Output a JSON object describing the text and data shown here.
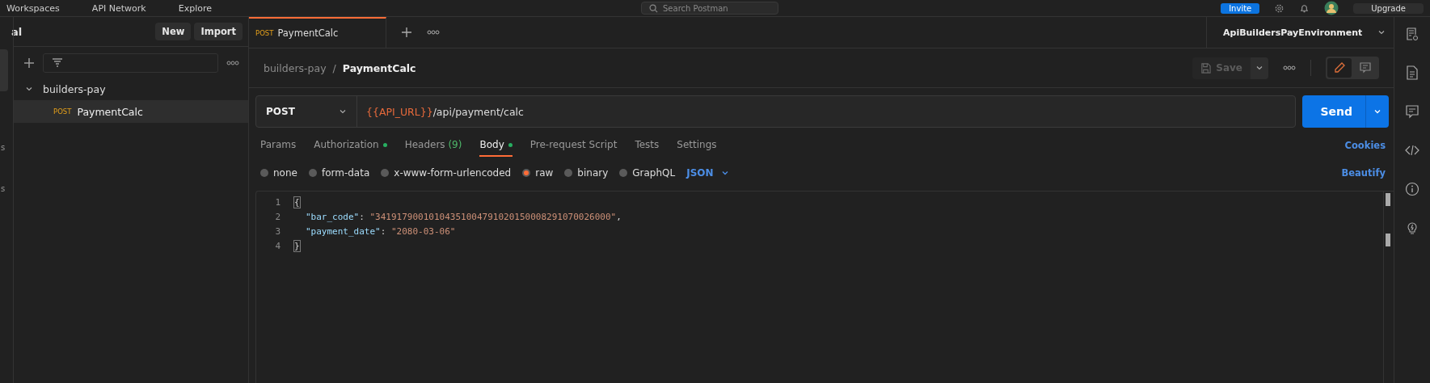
{
  "top_bar": {
    "nav": [
      "Workspaces",
      "API Network",
      "Explore"
    ],
    "search": {
      "placeholder": "Search Postman"
    },
    "invite": "Invite",
    "upgrade": "Upgrade"
  },
  "left_rail": {
    "labels": [
      "s",
      "s"
    ]
  },
  "sidebar": {
    "workspace_title": "al",
    "buttons": [
      "New",
      "Import"
    ],
    "tree": [
      {
        "label": "builders-pay",
        "expanded": true,
        "children": [
          {
            "method": "POST",
            "label": "PaymentCalc",
            "selected": true
          }
        ]
      }
    ]
  },
  "tabs": [
    {
      "method": "POST",
      "label": "PaymentCalc",
      "selected": true
    }
  ],
  "environment": "ApiBuildersPayEnvironment",
  "breadcrumb": {
    "parent": "builders-pay",
    "separator": "/",
    "current": "PaymentCalc"
  },
  "save": {
    "label": "Save",
    "disabled": true
  },
  "mode_toggle": [
    {
      "kind": "edit",
      "selected": true
    },
    {
      "kind": "comment",
      "selected": false
    }
  ],
  "request": {
    "method": "POST",
    "url_variable": "{{API_URL}}",
    "url_path": "/api/payment/calc",
    "send": "Send"
  },
  "request_tabs": [
    {
      "label": "Params",
      "dot": false,
      "selected": false
    },
    {
      "label": "Authorization",
      "dot": true,
      "selected": false
    },
    {
      "label": "Headers",
      "dot": false,
      "count": "(9)",
      "selected": false
    },
    {
      "label": "Body",
      "dot": true,
      "selected": true
    },
    {
      "label": "Pre-request Script",
      "dot": false,
      "selected": false
    },
    {
      "label": "Tests",
      "dot": false,
      "selected": false
    },
    {
      "label": "Settings",
      "dot": false,
      "selected": false
    }
  ],
  "cookies": "Cookies",
  "body_types": [
    {
      "label": "none",
      "selected": false
    },
    {
      "label": "form-data",
      "selected": false
    },
    {
      "label": "x-www-form-urlencoded",
      "selected": false
    },
    {
      "label": "raw",
      "selected": true
    },
    {
      "label": "binary",
      "selected": false
    },
    {
      "label": "GraphQL",
      "selected": false
    }
  ],
  "language": "JSON",
  "beautify": "Beautify",
  "editor": {
    "lines": [
      {
        "number": "1",
        "tokens": [
          {
            "kind": "punct",
            "text": "{"
          }
        ]
      },
      {
        "number": "2",
        "tokens": [
          {
            "kind": "key",
            "text": "\"bar_code\""
          },
          {
            "kind": "punct",
            "text": ": "
          },
          {
            "kind": "string",
            "text": "\"34191790010104351004791020150008291070026000\""
          },
          {
            "kind": "punct",
            "text": ","
          }
        ]
      },
      {
        "number": "3",
        "tokens": [
          {
            "kind": "key",
            "text": "\"payment_date\""
          },
          {
            "kind": "punct",
            "text": ": "
          },
          {
            "kind": "string",
            "text": "\"2080-03-06\""
          }
        ]
      },
      {
        "number": "4",
        "tokens": [
          {
            "kind": "punct",
            "text": "}"
          }
        ]
      }
    ]
  }
}
